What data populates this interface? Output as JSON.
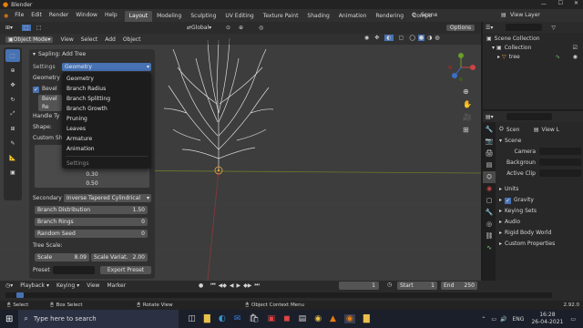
{
  "window": {
    "title": "Blender"
  },
  "menu": {
    "items": [
      "File",
      "Edit",
      "Render",
      "Window",
      "Help"
    ],
    "workspaces": [
      "Layout",
      "Modeling",
      "Sculpting",
      "UV Editing",
      "Texture Paint",
      "Shading",
      "Animation",
      "Rendering",
      "Compo"
    ],
    "scene": "Scene",
    "view_layer": "View Layer"
  },
  "viewport": {
    "mode": "Object Mode",
    "menus": [
      "View",
      "Select",
      "Add",
      "Object"
    ],
    "transform": "Global",
    "options": "Options"
  },
  "panel": {
    "title": "Sapling: Add Tree",
    "settings_label": "Settings",
    "settings_value": "Geometry",
    "geometry_label": "Geometry",
    "bevel_label": "Bevel",
    "bevel_btn": "Bevel Re",
    "handle_label": "Handle Ty",
    "shape_label": "Shape:",
    "custom_label": "Custom Sh",
    "val1": "0.30",
    "val2": "0.50",
    "secondary_label": "Secondary",
    "secondary_value": "Inverse Tapered Cylindrical",
    "branch_distribution_label": "Branch Distribution",
    "branch_distribution_value": "1.50",
    "branch_rings_label": "Branch Rings",
    "branch_rings_value": "0",
    "random_seed_label": "Random Seed",
    "random_seed_value": "0",
    "tree_scale_label": "Tree Scale:",
    "scale_label": "Scale",
    "scale_value": "8.09",
    "scale_variation_label": "Scale Variat.",
    "scale_variation_value": "2.00",
    "preset_label": "Preset",
    "export_btn": "Export Preset"
  },
  "dropdown": {
    "items": [
      "Geometry",
      "Branch Radius",
      "Branch Splitting",
      "Branch Growth",
      "Pruning",
      "Leaves",
      "Armature",
      "Animation"
    ],
    "footer": "Settings"
  },
  "outliner": {
    "scene_collection": "Scene Collection",
    "collection": "Collection",
    "tree": "tree"
  },
  "properties": {
    "scene_tab": "Scen",
    "view_layer_tab": "View L",
    "section": "Scene",
    "camera_label": "Camera",
    "background_label": "Backgroun",
    "active_clip_label": "Active Clip",
    "subsections": [
      "Units",
      "Gravity",
      "Keying Sets",
      "Audio",
      "Rigid Body World",
      "Custom Properties"
    ]
  },
  "timeline": {
    "menus": [
      "Playback",
      "Keying",
      "View",
      "Marker"
    ],
    "frame": "1",
    "start_label": "Start",
    "start": "1",
    "end_label": "End",
    "end": "250"
  },
  "status": {
    "select": "Select",
    "box_select": "Box Select",
    "rotate_view": "Rotate View",
    "context_menu": "Object Context Menu",
    "version": "2.92.0"
  },
  "taskbar": {
    "search_placeholder": "Type here to search",
    "language": "ENG",
    "time": "16:28",
    "date": "26-04-2021",
    "colors": {
      "accent": "#4772b3",
      "bg": "#3d3d3d"
    }
  }
}
